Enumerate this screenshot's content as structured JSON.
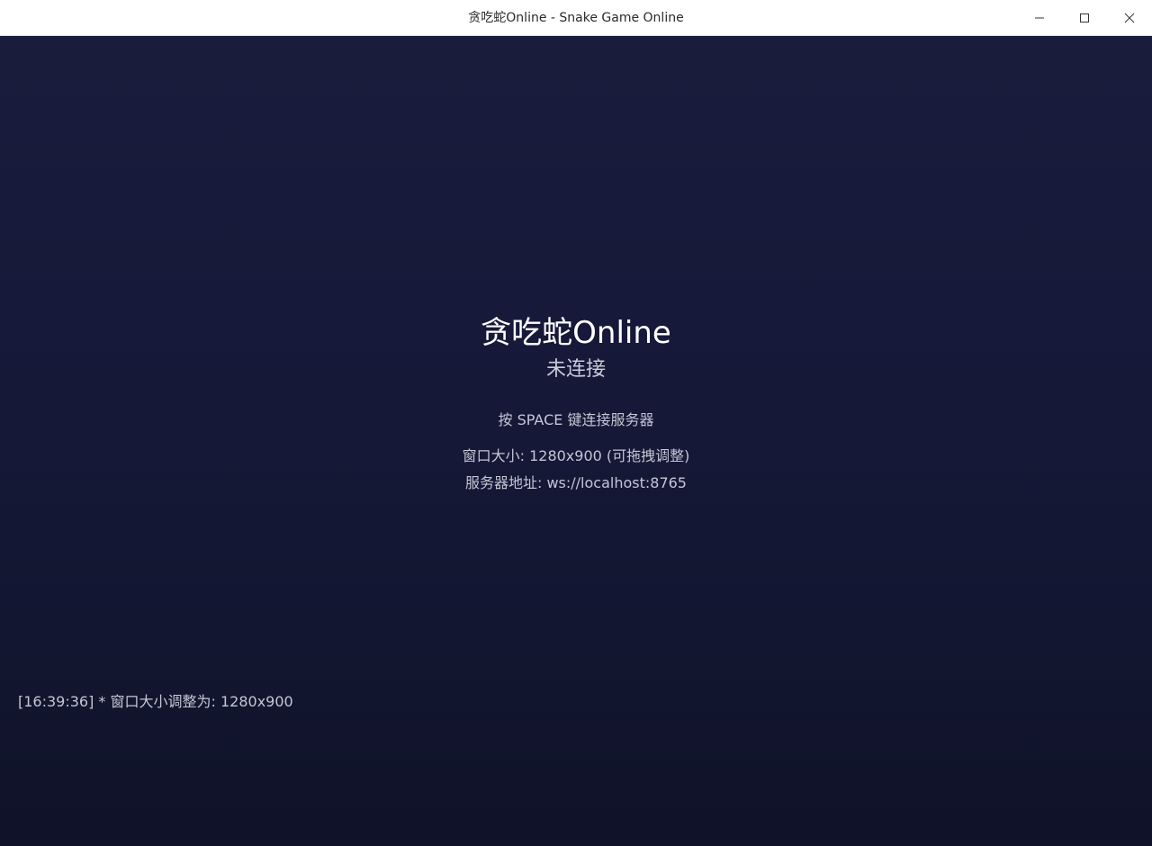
{
  "window": {
    "title": "贪吃蛇Online - Snake Game Online",
    "controls": [
      "minimize-icon",
      "maximize-icon",
      "close-icon"
    ]
  },
  "game": {
    "title": "贪吃蛇Online",
    "status": "未连接",
    "hint": "按 SPACE 键连接服务器",
    "window_size": "窗口大小: 1280x900 (可拖拽调整)",
    "server_address": "服务器地址: ws://localhost:8765"
  },
  "log": {
    "message": "[16:39:36] * 窗口大小调整为: 1280x900"
  },
  "colors": {
    "background": "#17193a",
    "title_text": "#ffffff",
    "secondary_text": "#c4c7d4"
  }
}
